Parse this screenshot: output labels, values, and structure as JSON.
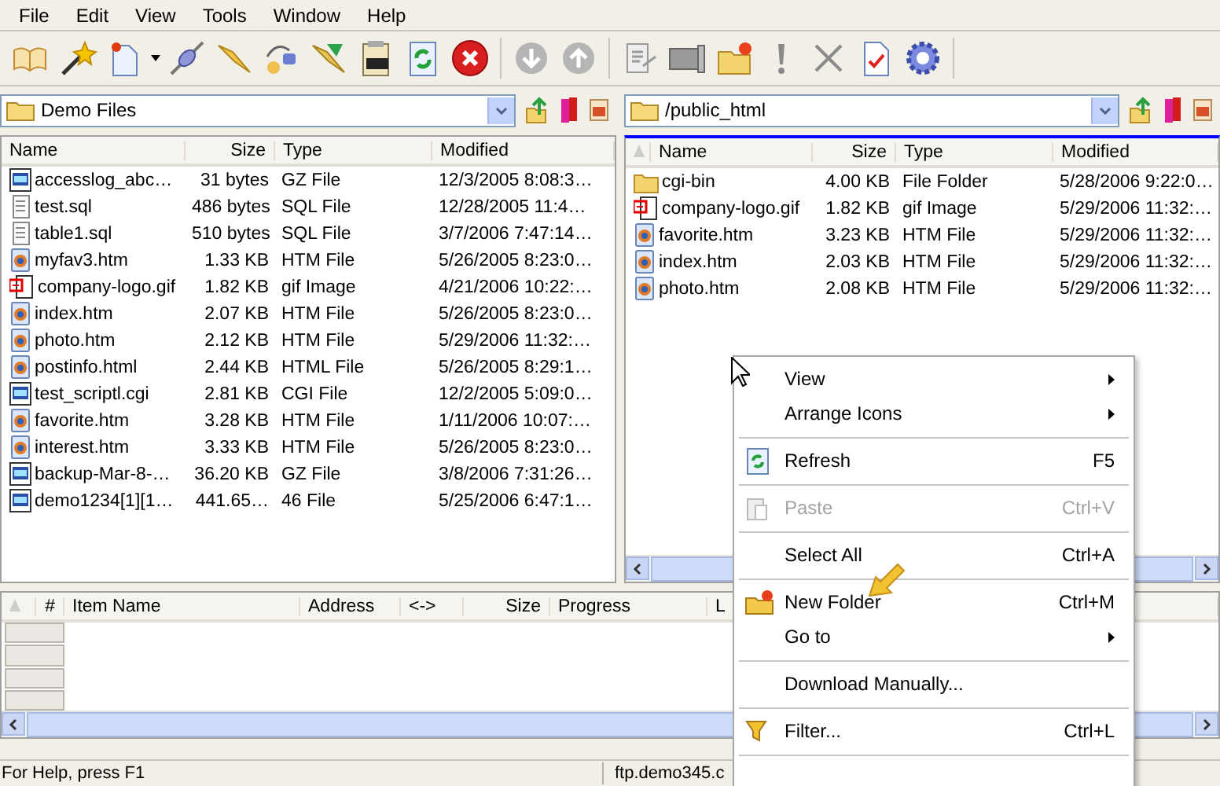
{
  "menu_bar": [
    "File",
    "Edit",
    "View",
    "Tools",
    "Window",
    "Help"
  ],
  "local_pane": {
    "path": "Demo Files",
    "columns": [
      "Name",
      "Size",
      "Type",
      "Modified"
    ],
    "rows": [
      {
        "kind": "archive",
        "name": "accesslog_abc…",
        "size": "31 bytes",
        "type": "GZ File",
        "modified": "12/3/2005 8:08:3…"
      },
      {
        "kind": "text",
        "name": "test.sql",
        "size": "486 bytes",
        "type": "SQL File",
        "modified": "12/28/2005 11:4…"
      },
      {
        "kind": "text",
        "name": "table1.sql",
        "size": "510 bytes",
        "type": "SQL File",
        "modified": "3/7/2006 7:47:14…"
      },
      {
        "kind": "web",
        "name": "myfav3.htm",
        "size": "1.33 KB",
        "type": "HTM File",
        "modified": "5/26/2005 8:23:0…"
      },
      {
        "kind": "image",
        "name": "company-logo.gif",
        "size": "1.82 KB",
        "type": "gif Image",
        "modified": "4/21/2006 10:22:…"
      },
      {
        "kind": "web",
        "name": "index.htm",
        "size": "2.07 KB",
        "type": "HTM File",
        "modified": "5/26/2005 8:23:0…"
      },
      {
        "kind": "web",
        "name": "photo.htm",
        "size": "2.12 KB",
        "type": "HTM File",
        "modified": "5/29/2006 11:32:…"
      },
      {
        "kind": "web",
        "name": "postinfo.html",
        "size": "2.44 KB",
        "type": "HTML File",
        "modified": "5/26/2005 8:29:1…"
      },
      {
        "kind": "archive",
        "name": "test_scriptl.cgi",
        "size": "2.81 KB",
        "type": "CGI File",
        "modified": "12/2/2005 5:09:0…"
      },
      {
        "kind": "web",
        "name": "favorite.htm",
        "size": "3.28 KB",
        "type": "HTM File",
        "modified": "1/11/2006 10:07:…"
      },
      {
        "kind": "web",
        "name": "interest.htm",
        "size": "3.33 KB",
        "type": "HTM File",
        "modified": "5/26/2005 8:23:0…"
      },
      {
        "kind": "archive",
        "name": "backup-Mar-8-…",
        "size": "36.20 KB",
        "type": "GZ File",
        "modified": "3/8/2006 7:31:26…"
      },
      {
        "kind": "archive",
        "name": "demo1234[1][1…",
        "size": "441.65…",
        "type": "46 File",
        "modified": "5/25/2006 6:47:1…"
      }
    ]
  },
  "remote_pane": {
    "path": "/public_html",
    "columns": [
      "Name",
      "Size",
      "Type",
      "Modified"
    ],
    "rows": [
      {
        "kind": "folder",
        "name": "cgi-bin",
        "size": "4.00 KB",
        "type": "File Folder",
        "modified": "5/28/2006 9:22:0…"
      },
      {
        "kind": "image",
        "name": "company-logo.gif",
        "size": "1.82 KB",
        "type": "gif Image",
        "modified": "5/29/2006 11:32:…"
      },
      {
        "kind": "web",
        "name": "favorite.htm",
        "size": "3.23 KB",
        "type": "HTM File",
        "modified": "5/29/2006 11:32:…"
      },
      {
        "kind": "web",
        "name": "index.htm",
        "size": "2.03 KB",
        "type": "HTM File",
        "modified": "5/29/2006 11:32:…"
      },
      {
        "kind": "web",
        "name": "photo.htm",
        "size": "2.08 KB",
        "type": "HTM File",
        "modified": "5/29/2006 11:32:…"
      }
    ]
  },
  "queue": {
    "columns": [
      "#",
      "Item Name",
      "Address",
      "<->",
      "Size",
      "Progress",
      "L"
    ]
  },
  "context_menu": [
    {
      "kind": "item",
      "label": "View",
      "submenu": true,
      "disabled": false
    },
    {
      "kind": "item",
      "label": "Arrange Icons",
      "submenu": true,
      "disabled": false
    },
    {
      "kind": "separator"
    },
    {
      "kind": "item",
      "label": "Refresh",
      "shortcut": "F5",
      "submenu": false,
      "disabled": false
    },
    {
      "kind": "separator"
    },
    {
      "kind": "item",
      "label": "Paste",
      "shortcut": "Ctrl+V",
      "submenu": false,
      "disabled": true
    },
    {
      "kind": "separator"
    },
    {
      "kind": "item",
      "label": "Select All",
      "shortcut": "Ctrl+A",
      "submenu": false,
      "disabled": false
    },
    {
      "kind": "separator"
    },
    {
      "kind": "item",
      "label": "New Folder",
      "shortcut": "Ctrl+M",
      "submenu": false,
      "disabled": false
    },
    {
      "kind": "item",
      "label": "Go to",
      "submenu": true,
      "disabled": false
    },
    {
      "kind": "separator"
    },
    {
      "kind": "item",
      "label": "Download Manually...",
      "submenu": false,
      "disabled": false
    },
    {
      "kind": "separator"
    },
    {
      "kind": "item",
      "label": "Filter...",
      "shortcut": "Ctrl+L",
      "submenu": false,
      "disabled": false
    },
    {
      "kind": "separator"
    }
  ],
  "status_bar": [
    "For Help, press F1",
    "ftp.demo345.c"
  ]
}
